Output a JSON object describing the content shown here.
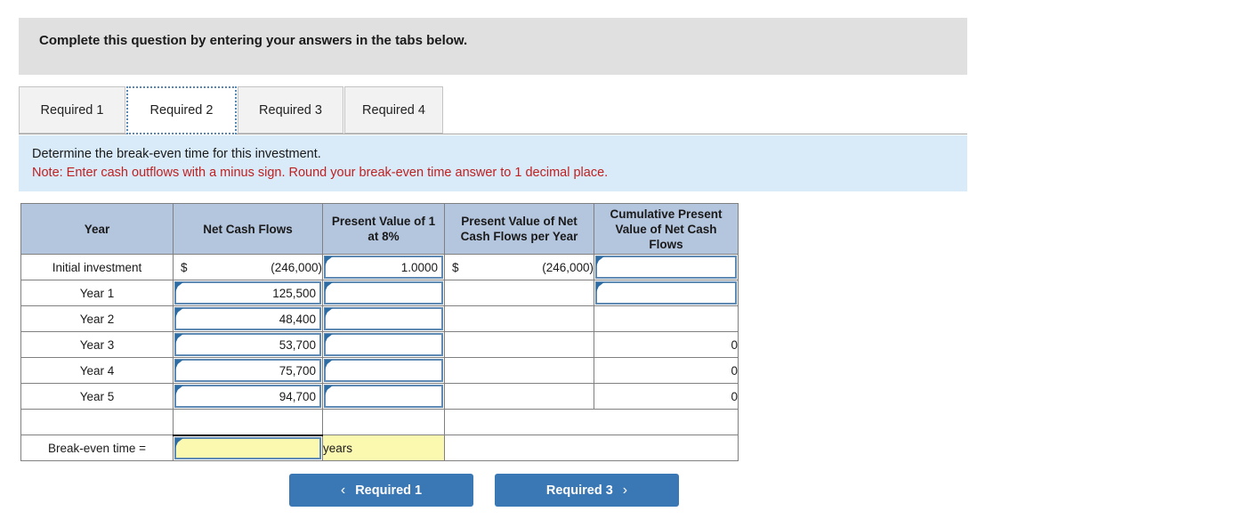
{
  "banner": {
    "text": "Complete this question by entering your answers in the tabs below."
  },
  "tabs": [
    {
      "label": "Required 1",
      "active": false
    },
    {
      "label": "Required 2",
      "active": true
    },
    {
      "label": "Required 3",
      "active": false
    },
    {
      "label": "Required 4",
      "active": false
    }
  ],
  "note": {
    "line1": "Determine the break-even time for this investment.",
    "line2": "Note: Enter cash outflows with a minus sign. Round your break-even time answer to 1 decimal place.",
    "line2_color": "#c02020"
  },
  "table": {
    "headers": [
      "Year",
      "Net Cash Flows",
      "Present Value of 1 at 8%",
      "Present Value of Net Cash Flows per Year",
      "Cumulative Present Value of Net Cash Flows"
    ],
    "rows": [
      {
        "year": "Initial investment",
        "net_cash_flows": "(246,000)",
        "net_cash_flows_currency": "$",
        "pv_factor": "1.0000",
        "pv_per_year": "(246,000)",
        "pv_per_year_currency": "$",
        "cumulative": ""
      },
      {
        "year": "Year 1",
        "net_cash_flows": "125,500",
        "pv_factor": "",
        "pv_per_year": "",
        "cumulative": ""
      },
      {
        "year": "Year 2",
        "net_cash_flows": "48,400",
        "pv_factor": "",
        "pv_per_year": "",
        "cumulative": ""
      },
      {
        "year": "Year 3",
        "net_cash_flows": "53,700",
        "pv_factor": "",
        "pv_per_year": "",
        "cumulative": "0"
      },
      {
        "year": "Year 4",
        "net_cash_flows": "75,700",
        "pv_factor": "",
        "pv_per_year": "",
        "cumulative": "0"
      },
      {
        "year": "Year 5",
        "net_cash_flows": "94,700",
        "pv_factor": "",
        "pv_per_year": "",
        "cumulative": "0"
      }
    ],
    "breakeven": {
      "label": "Break-even time =",
      "value": "",
      "unit": "years"
    }
  },
  "footer": {
    "prev_label": "Required 1",
    "next_label": "Required 3",
    "prev_icon": "chevron-left-icon",
    "next_icon": "chevron-right-icon",
    "prev_glyph": "‹",
    "next_glyph": "›",
    "button_color": "#3a77b5"
  },
  "colors": {
    "header_banner": "#e0e0e0",
    "note_banner": "#d9ebf9",
    "table_header": "#b4c5de",
    "input_border": "#5e8ab4",
    "input_highlight": "#fbf8b0"
  }
}
